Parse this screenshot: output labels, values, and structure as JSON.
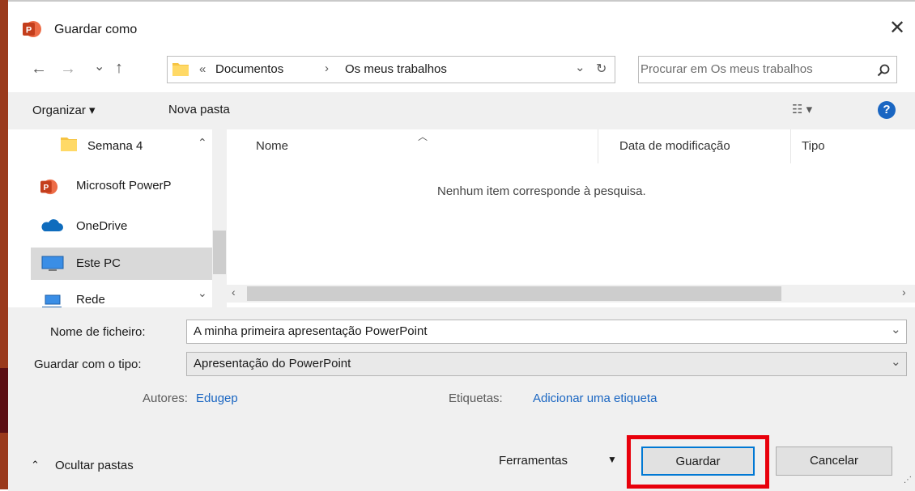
{
  "window": {
    "title": "Guardar como",
    "app_icon": "powerpoint-icon"
  },
  "nav": {
    "back": "←",
    "forward": "→",
    "recent": "⌄",
    "up": "↑",
    "breadcrumb_prefix": "«",
    "breadcrumb": [
      "Documentos",
      "Os meus trabalhos"
    ],
    "separator": "›",
    "dropdown": "⌄",
    "refresh": "↻",
    "search_placeholder": "Procurar em Os meus trabalhos"
  },
  "toolbar": {
    "organize": "Organizar ▾",
    "new_folder": "Nova pasta",
    "view": "☷ ▾",
    "help": "?"
  },
  "sidebar": {
    "items": [
      {
        "label": "Semana 4",
        "icon": "folder-icon"
      },
      {
        "label": "Microsoft PowerP",
        "icon": "powerpoint-icon"
      },
      {
        "label": "OneDrive",
        "icon": "onedrive-icon"
      },
      {
        "label": "Este PC",
        "icon": "computer-icon",
        "selected": true
      },
      {
        "label": "Rede",
        "icon": "network-icon"
      }
    ]
  },
  "list": {
    "columns": [
      "Nome",
      "Data de modificação",
      "Tipo"
    ],
    "empty_message": "Nenhum item corresponde à pesquisa."
  },
  "form": {
    "filename_label": "Nome de ficheiro:",
    "filename_value": "A minha primeira apresentação PowerPoint",
    "type_label": "Guardar com o tipo:",
    "type_value": "Apresentação do PowerPoint",
    "authors_label": "Autores:",
    "authors_value": "Edugep",
    "tags_label": "Etiquetas:",
    "tags_value": "Adicionar uma etiqueta"
  },
  "footer": {
    "hide_folders": "Ocultar pastas",
    "tools": "Ferramentas",
    "save": "Guardar",
    "cancel": "Cancelar"
  },
  "colors": {
    "highlight_box": "#e8000b",
    "link": "#1a66c2",
    "selected_bg": "#d9d9d9"
  }
}
